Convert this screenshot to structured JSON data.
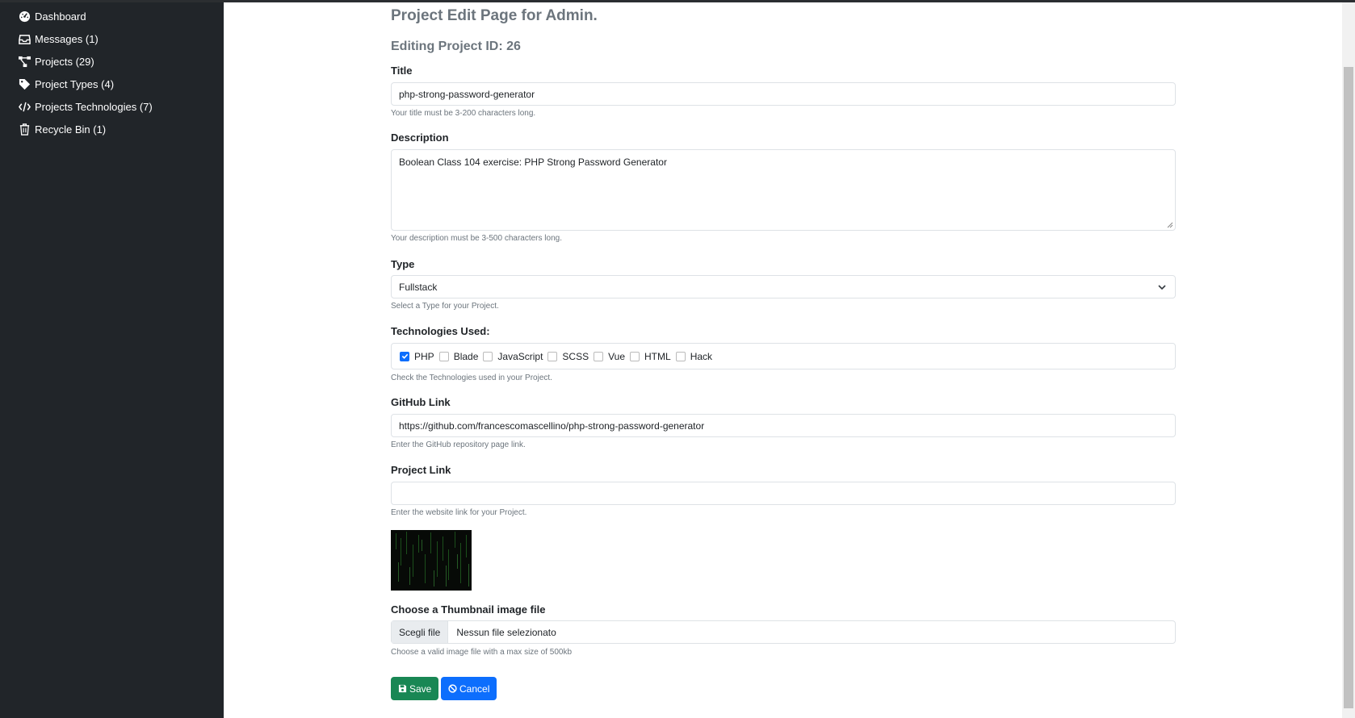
{
  "sidebar": {
    "items": [
      {
        "label": "Dashboard",
        "icon": "dashboard-icon"
      },
      {
        "label": "Messages (1)",
        "icon": "inbox-icon"
      },
      {
        "label": "Projects (29)",
        "icon": "project-diagram-icon"
      },
      {
        "label": "Project Types (4)",
        "icon": "tag-icon"
      },
      {
        "label": "Projects Technologies (7)",
        "icon": "code-icon"
      },
      {
        "label": "Recycle Bin (1)",
        "icon": "trash-icon"
      }
    ]
  },
  "page": {
    "heading": "Project Edit Page for Admin.",
    "subheading": "Editing Project ID: 26"
  },
  "form": {
    "title": {
      "label": "Title",
      "value": "php-strong-password-generator",
      "help": "Your title must be 3-200 characters long."
    },
    "description": {
      "label": "Description",
      "value": "Boolean Class 104 exercise: PHP Strong Password Generator",
      "help": "Your description must be 3-500 characters long."
    },
    "type": {
      "label": "Type",
      "value": "Fullstack",
      "help": "Select a Type for your Project."
    },
    "technologies": {
      "label": "Technologies Used:",
      "options": [
        {
          "label": "PHP",
          "checked": true
        },
        {
          "label": "Blade",
          "checked": false
        },
        {
          "label": "JavaScript",
          "checked": false
        },
        {
          "label": "SCSS",
          "checked": false
        },
        {
          "label": "Vue",
          "checked": false
        },
        {
          "label": "HTML",
          "checked": false
        },
        {
          "label": "Hack",
          "checked": false
        }
      ],
      "help": "Check the Technologies used in your Project."
    },
    "github": {
      "label": "GitHub Link",
      "value": "https://github.com/francescomascellino/php-strong-password-generator",
      "help": "Enter the GitHub repository page link."
    },
    "project_link": {
      "label": "Project Link",
      "value": "",
      "help": "Enter the website link for your Project."
    },
    "thumbnail": {
      "label": "Choose a Thumbnail image file",
      "button": "Scegli file",
      "file_name": "Nessun file selezionato",
      "help": "Choose a valid image file with a max size of 500kb"
    },
    "save_label": "Save",
    "cancel_label": "Cancel"
  },
  "colors": {
    "sidebar_bg": "#212529",
    "save_bg": "#198754",
    "cancel_bg": "#0d6efd",
    "checkbox_checked": "#0d6efd"
  }
}
